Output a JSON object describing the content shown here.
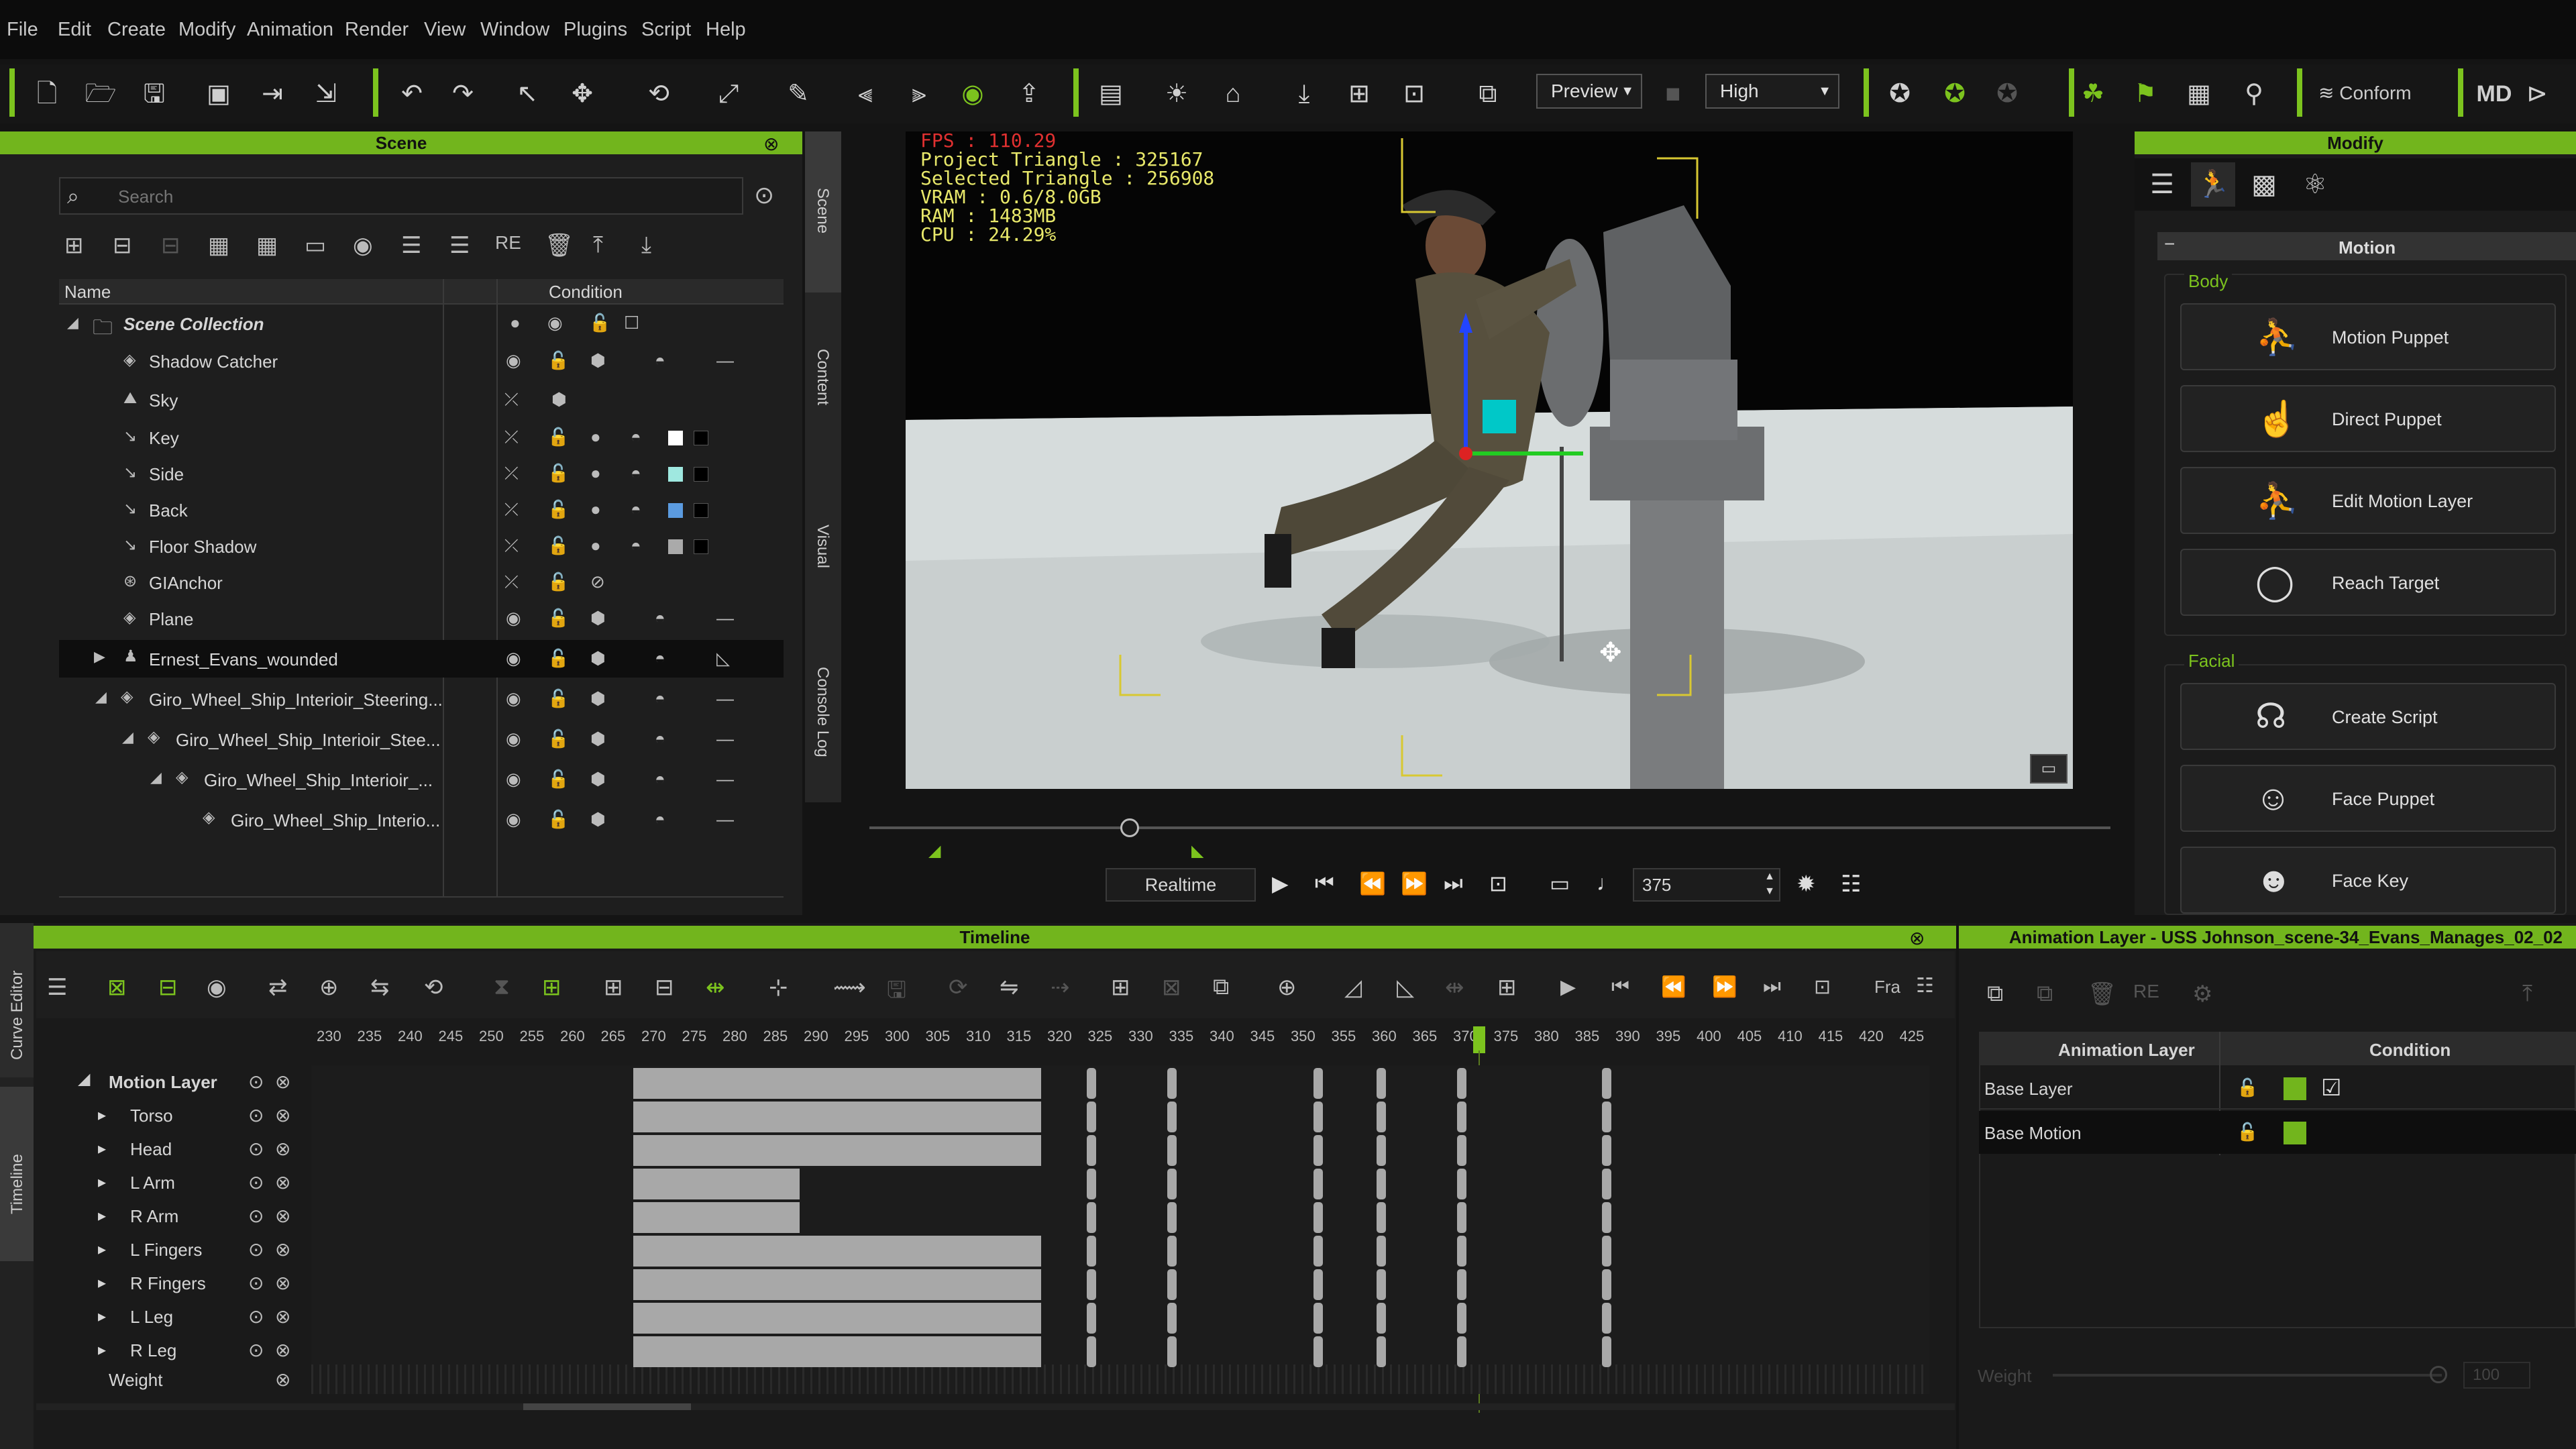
{
  "menu": [
    "File",
    "Edit",
    "Create",
    "Modify",
    "Animation",
    "Render",
    "View",
    "Window",
    "Plugins",
    "Script",
    "Help"
  ],
  "toolbar": {
    "preview": "Preview",
    "quality": "High",
    "conform": "Conform"
  },
  "scene": {
    "title": "Scene",
    "search_placeholder": "Search",
    "col_name": "Name",
    "col_condition": "Condition",
    "items": [
      {
        "label": "Scene Collection"
      },
      {
        "label": "Shadow Catcher"
      },
      {
        "label": "Sky"
      },
      {
        "label": "Key"
      },
      {
        "label": "Side"
      },
      {
        "label": "Back"
      },
      {
        "label": "Floor Shadow"
      },
      {
        "label": "GIAnchor"
      },
      {
        "label": "Plane"
      },
      {
        "label": "Ernest_Evans_wounded"
      },
      {
        "label": "Giro_Wheel_Ship_Interioir_Steering..."
      },
      {
        "label": "Giro_Wheel_Ship_Interioir_Stee..."
      },
      {
        "label": "Giro_Wheel_Ship_Interioir_..."
      },
      {
        "label": "Giro_Wheel_Ship_Interio..."
      }
    ],
    "tabs": [
      "Scene",
      "Content",
      "Visual",
      "Console Log"
    ]
  },
  "viewport": {
    "fps": "FPS : 110.29",
    "project_triangle": "Project Triangle : 325167",
    "selected_triangle": "Selected Triangle : 256908",
    "vram": "VRAM : 0.6/8.0GB",
    "ram": "RAM : 1483MB",
    "cpu": "CPU : 24.29%",
    "realtime": "Realtime",
    "frame": "375"
  },
  "modify": {
    "title": "Modify",
    "motion_header": "Motion",
    "body_label": "Body",
    "facial_label": "Facial",
    "body_buttons": [
      "Motion Puppet",
      "Direct Puppet",
      "Edit Motion Layer",
      "Reach Target"
    ],
    "facial_buttons": [
      "Create Script",
      "Face Puppet",
      "Face Key"
    ]
  },
  "timeline": {
    "title": "Timeline",
    "frame_label": "Fra",
    "side_tabs": [
      "Curve Editor",
      "Timeline"
    ],
    "ruler": [
      "230",
      "235",
      "240",
      "245",
      "250",
      "255",
      "260",
      "265",
      "270",
      "275",
      "280",
      "285",
      "290",
      "295",
      "300",
      "305",
      "310",
      "315",
      "320",
      "325",
      "330",
      "335",
      "340",
      "345",
      "350",
      "355",
      "360",
      "365",
      "370",
      "375",
      "380",
      "385",
      "390",
      "395",
      "400",
      "405",
      "410",
      "415",
      "420",
      "425"
    ],
    "tracks": [
      "Motion Layer",
      "Torso",
      "Head",
      "L Arm",
      "R Arm",
      "L Fingers",
      "R Fingers",
      "L Leg",
      "R Leg"
    ],
    "weight": "Weight"
  },
  "anim_layer": {
    "title": "Animation Layer - USS Johnson_scene-34_Evans_Manages_02_02",
    "col_layer": "Animation Layer",
    "col_condition": "Condition",
    "rows": [
      "Base Layer",
      "Base Motion"
    ],
    "weight": "Weight",
    "weight_value": "100"
  },
  "colors": {
    "accent": "#72b51d",
    "stats": "#e8e86a",
    "fps": "#e03030"
  }
}
